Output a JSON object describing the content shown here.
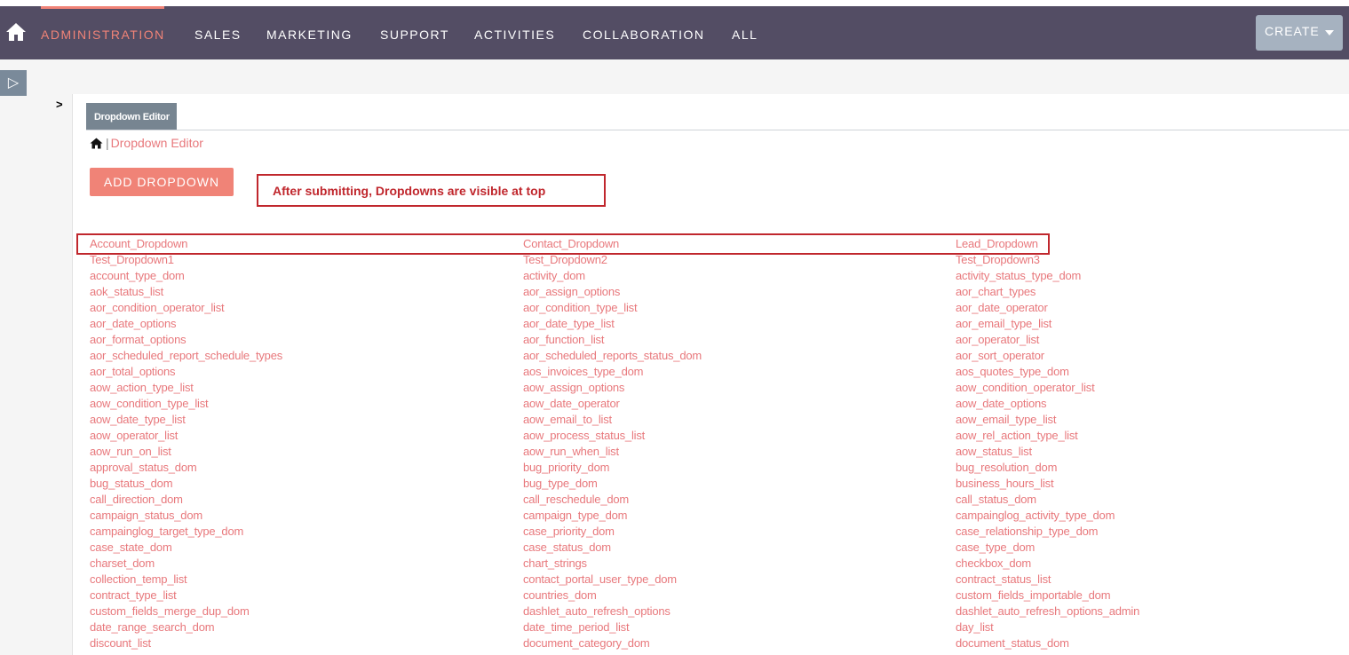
{
  "nav": {
    "items": [
      {
        "label": "ADMINISTRATION",
        "active": true
      },
      {
        "label": "SALES",
        "active": false
      },
      {
        "label": "MARKETING",
        "active": false
      },
      {
        "label": "SUPPORT",
        "active": false
      },
      {
        "label": "ACTIVITIES",
        "active": false
      },
      {
        "label": "COLLABORATION",
        "active": false
      },
      {
        "label": "ALL",
        "active": false
      }
    ],
    "create_label": "CREATE"
  },
  "sidebar": {
    "toggle_glyph": "▷"
  },
  "collapse_glyph": ">",
  "tab": {
    "label": "Dropdown Editor"
  },
  "breadcrumb": {
    "separator": "|",
    "current": "Dropdown Editor"
  },
  "add_button_label": "ADD DROPDOWN",
  "annotation": {
    "text": "After submitting, Dropdowns are visible at top"
  },
  "colors": {
    "nav_bg": "#534d64",
    "accent": "#f08377",
    "link": "#e8787c",
    "annotation": "#c0272d"
  },
  "dropdowns": {
    "col1": [
      "Account_Dropdown",
      "Test_Dropdown1",
      "account_type_dom",
      "aok_status_list",
      "aor_condition_operator_list",
      "aor_date_options",
      "aor_format_options",
      "aor_scheduled_report_schedule_types",
      "aor_total_options",
      "aow_action_type_list",
      "aow_condition_type_list",
      "aow_date_type_list",
      "aow_operator_list",
      "aow_run_on_list",
      "approval_status_dom",
      "bug_status_dom",
      "call_direction_dom",
      "campaign_status_dom",
      "campainglog_target_type_dom",
      "case_state_dom",
      "charset_dom",
      "collection_temp_list",
      "contract_type_list",
      "custom_fields_merge_dup_dom",
      "date_range_search_dom",
      "discount_list"
    ],
    "col2": [
      "Contact_Dropdown",
      "Test_Dropdown2",
      "activity_dom",
      "aor_assign_options",
      "aor_condition_type_list",
      "aor_date_type_list",
      "aor_function_list",
      "aor_scheduled_reports_status_dom",
      "aos_invoices_type_dom",
      "aow_assign_options",
      "aow_date_operator",
      "aow_email_to_list",
      "aow_process_status_list",
      "aow_run_when_list",
      "bug_priority_dom",
      "bug_type_dom",
      "call_reschedule_dom",
      "campaign_type_dom",
      "case_priority_dom",
      "case_status_dom",
      "chart_strings",
      "contact_portal_user_type_dom",
      "countries_dom",
      "dashlet_auto_refresh_options",
      "date_time_period_list",
      "document_category_dom"
    ],
    "col3": [
      "Lead_Dropdown",
      "Test_Dropdown3",
      "activity_status_type_dom",
      "aor_chart_types",
      "aor_date_operator",
      "aor_email_type_list",
      "aor_operator_list",
      "aor_sort_operator",
      "aos_quotes_type_dom",
      "aow_condition_operator_list",
      "aow_date_options",
      "aow_email_type_list",
      "aow_rel_action_type_list",
      "aow_status_list",
      "bug_resolution_dom",
      "business_hours_list",
      "call_status_dom",
      "campainglog_activity_type_dom",
      "case_relationship_type_dom",
      "case_type_dom",
      "checkbox_dom",
      "contract_status_list",
      "custom_fields_importable_dom",
      "dashlet_auto_refresh_options_admin",
      "day_list",
      "document_status_dom"
    ]
  }
}
